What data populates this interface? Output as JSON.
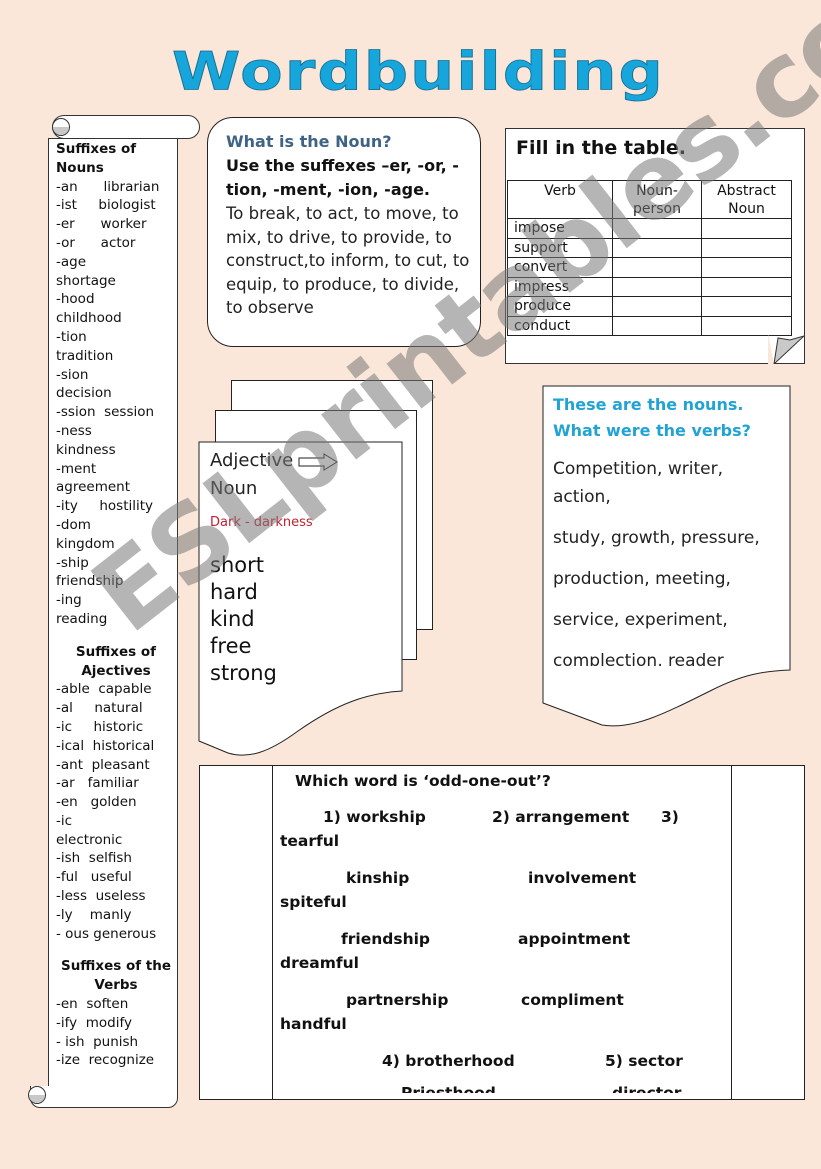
{
  "title": "Wordbuilding",
  "sidebar": {
    "nouns_heading": "Suffixes of Nouns",
    "nouns": [
      "-an      librarian",
      "-ist     biologist",
      "-er      worker",
      "-or      actor",
      "-age",
      "shortage",
      "-hood",
      "childhood",
      "-tion",
      "tradition",
      "-sion",
      "decision",
      "-ssion  session",
      "-ness",
      "kindness",
      "-ment",
      "agreement",
      "-ity     hostility",
      "-dom",
      "kingdom",
      "-ship",
      "friendship",
      "-ing",
      "reading"
    ],
    "adjectives_heading": "Suffixes of Ajectives",
    "adjectives": [
      "-able  capable",
      "-al     natural",
      "-ic     historic",
      "-ical  historical",
      "-ant  pleasant",
      "-ar   familiar",
      "-en   golden",
      "-ic",
      "electronic",
      "-ish  selfish",
      "-ful   useful",
      "-less  useless",
      "-ly    manly",
      "- ous generous"
    ],
    "verbs_heading": "Suffixes of the Verbs",
    "verbs": [
      "-en  soften",
      "-ify  modify",
      "- ish  punish",
      "-ize  recognize"
    ]
  },
  "noun_box": {
    "question": "What is the Noun?",
    "instruction": "Use the suffexes –er, -or, -tion, -ment, -ion, -age.",
    "verbs_text": "To break, to act, to move, to mix, to drive, to provide, to construct,to inform, to cut, to equip, to produce, to divide, to observe"
  },
  "fill_table": {
    "heading": "Fill in the table.",
    "columns": [
      "Verb",
      "Noun-person",
      "Abstract Noun"
    ],
    "rows": [
      [
        "impose",
        "",
        ""
      ],
      [
        "support",
        "",
        ""
      ],
      [
        "convert",
        "",
        ""
      ],
      [
        "impress",
        "",
        ""
      ],
      [
        "produce",
        "",
        ""
      ],
      [
        "conduct",
        "",
        ""
      ]
    ]
  },
  "adjective_page": {
    "label_adjective": "Adjective",
    "label_noun": "Noun",
    "example": "Dark  - darkness",
    "words": [
      "short",
      "hard",
      "kind",
      "free",
      "strong"
    ],
    "example_color": "#c02030"
  },
  "nouns_page": {
    "heading_1": "These are the nouns.",
    "heading_2": "What were the verbs?",
    "lines": [
      "Competition, writer, action,",
      "study, growth, pressure,",
      "production, meeting,",
      "service, experiment,",
      "complection, reader"
    ],
    "heading_color": "#22a3d6"
  },
  "odd_one_out": {
    "question": "Which word is ‘odd-one-out’?",
    "items": [
      {
        "text": "1) workship",
        "pos": "a1"
      },
      {
        "text": "2) arrangement",
        "pos": "b1"
      },
      {
        "text": "3)",
        "pos": "c1"
      },
      {
        "text": "tearful",
        "pos": "d1"
      },
      {
        "text": "kinship",
        "pos": "a2"
      },
      {
        "text": "involvement",
        "pos": "b2"
      },
      {
        "text": "spiteful",
        "pos": "d2"
      },
      {
        "text": "friendship",
        "pos": "a3"
      },
      {
        "text": "appointment",
        "pos": "b3"
      },
      {
        "text": "dreamful",
        "pos": "d3"
      },
      {
        "text": "partnership",
        "pos": "a4"
      },
      {
        "text": "compliment",
        "pos": "b4"
      },
      {
        "text": "handful",
        "pos": "d4"
      },
      {
        "text": "4) brotherhood",
        "pos": "a5"
      },
      {
        "text": "5) sector",
        "pos": "b5"
      },
      {
        "text": "Priesthood",
        "pos": "a6"
      },
      {
        "text": "director",
        "pos": "b6"
      }
    ]
  },
  "watermark": "ESLprintables.com"
}
